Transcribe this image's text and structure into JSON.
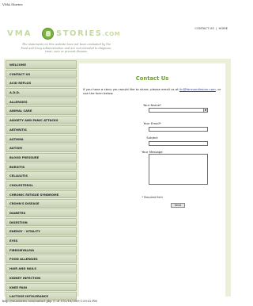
{
  "browser": {
    "page_title": "VMA Stories",
    "footer_url": "http://vmastories.com/contact.php (1 of 1)12/16/2009 1:59:52 PM"
  },
  "header": {
    "logo_left": "VMA",
    "logo_right": "STORIES",
    "logo_suffix": ".COM",
    "disclaimer": "The statements on this website have not been evaluated by the Food and Drug Administration and are not intended to diagnose, treat, cure or prevent disease.",
    "links": {
      "contact": "CONTACT US",
      "separator": "|",
      "home": "HOME"
    }
  },
  "sidebar": {
    "items": [
      "WELCOME",
      "CONTACT US",
      "ACID REFLUX",
      "A.D.D.",
      "ALLERGIES",
      "ANIMAL CARE",
      "ANXIETY AND PANIC ATTACKS",
      "ARTHRITIS",
      "ASTHMA",
      "AUTISM",
      "BLOOD PRESSURE",
      "BURSITIS",
      "CELLULITIS",
      "CHOLESTEROL",
      "CHRONIC FATIGUE SYNDROME",
      "CROHN'S DISEASE",
      "DIABETES",
      "DIGESTION",
      "ENERGY - VITALITY",
      "EYES",
      "FIBROMYALGIA",
      "FOOD ALLERGIES",
      "HAIR AND NAILS",
      "KIDNEY INFECTION",
      "KNEE PAIN",
      "LACTOSE INTOLERANCE"
    ]
  },
  "main": {
    "heading": "Contact Us",
    "intro_prefix": "If you have a story you would like to share, please email us at ",
    "email": "lin@farmandlesion.com",
    "intro_suffix": ", or use the form below.",
    "form": {
      "name_label": "Your Name*",
      "email_label": "Your Email*",
      "subject_label": "Subject",
      "message_label": "Your Message",
      "required_note": "* Required field",
      "send_label": "Send"
    }
  },
  "colors": {
    "accent": "#6a9f2a",
    "page_bg": "#eaf1d8",
    "link": "#2a3fb5"
  }
}
